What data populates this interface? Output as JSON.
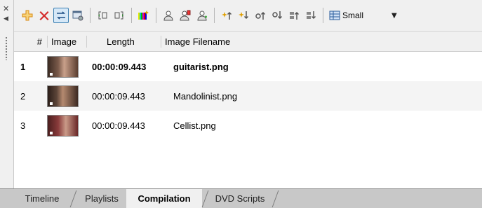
{
  "panel": {
    "close_icon": "close-icon",
    "pin_icon": "pin-arrow-icon"
  },
  "toolbar": {
    "buttons": [
      {
        "name": "add-icon",
        "color": "#f0a030"
      },
      {
        "name": "delete-icon",
        "color": "#d02020"
      },
      {
        "name": "swap-icon",
        "active": true
      },
      {
        "name": "properties-icon"
      },
      {
        "name": "fit-left-icon"
      },
      {
        "name": "fit-right-icon"
      },
      {
        "name": "color-bars-icon"
      },
      {
        "name": "user-icon"
      },
      {
        "name": "user-settings-icon"
      },
      {
        "name": "user-add-icon"
      },
      {
        "name": "effect-up-icon"
      },
      {
        "name": "effect-down-icon"
      },
      {
        "name": "move-up-icon"
      },
      {
        "name": "move-down-icon"
      },
      {
        "name": "move-top-icon"
      },
      {
        "name": "move-bottom-icon"
      }
    ],
    "size_select": {
      "icon": "thumbnail-size-icon",
      "value": "Small"
    }
  },
  "table": {
    "columns": [
      "#",
      "Image",
      "Length",
      "Image Filename"
    ],
    "rows": [
      {
        "num": "1",
        "length": "00:00:09.443",
        "filename": "guitarist.png",
        "selected": true,
        "thumb_color": "#7a5a4a"
      },
      {
        "num": "2",
        "length": "00:00:09.443",
        "filename": "Mandolinist.png",
        "selected": false,
        "thumb_color": "#5c4438"
      },
      {
        "num": "3",
        "length": "00:00:09.443",
        "filename": "Cellist.png",
        "selected": false,
        "thumb_color": "#8a3b3b"
      }
    ]
  },
  "tabs": [
    {
      "label": "Timeline",
      "active": false
    },
    {
      "label": "Playlists",
      "active": false
    },
    {
      "label": "Compilation",
      "active": true
    },
    {
      "label": "DVD Scripts",
      "active": false
    }
  ]
}
